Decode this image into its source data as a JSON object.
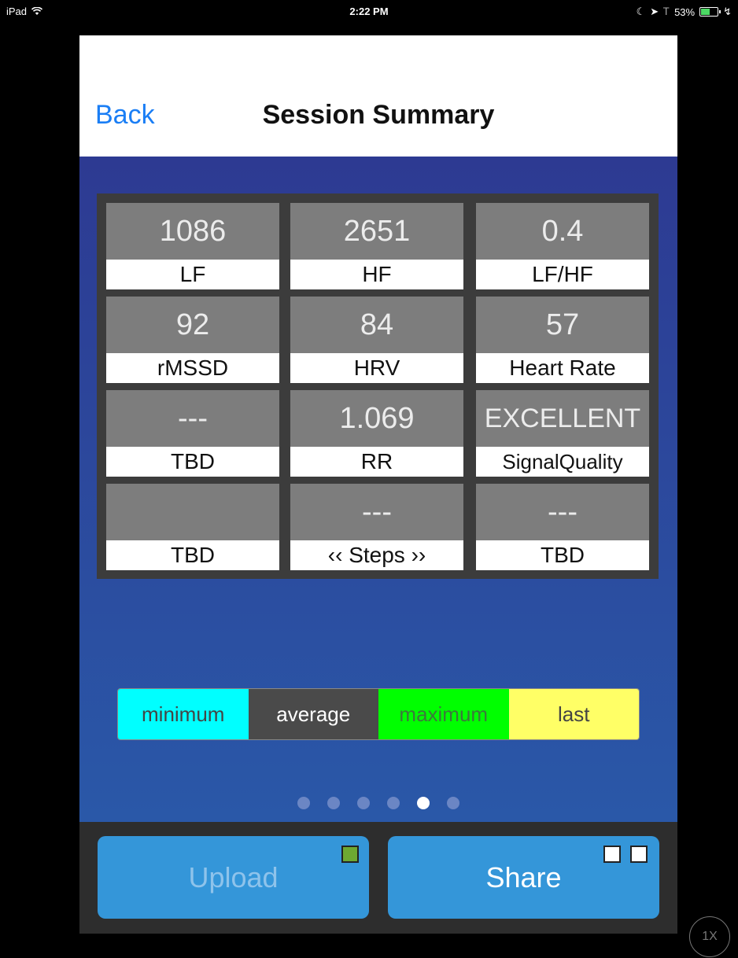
{
  "status_bar": {
    "device": "iPad",
    "time": "2:22 PM",
    "battery": "53%",
    "battery_level": 0.53
  },
  "nav": {
    "back_label": "Back",
    "title": "Session Summary"
  },
  "metrics": [
    {
      "value": "1086",
      "label": "LF"
    },
    {
      "value": "2651",
      "label": "HF"
    },
    {
      "value": "0.4",
      "label": "LF/HF"
    },
    {
      "value": "92",
      "label": "rMSSD"
    },
    {
      "value": "84",
      "label": "HRV"
    },
    {
      "value": "57",
      "label": "Heart Rate"
    },
    {
      "value": "---",
      "label": "TBD"
    },
    {
      "value": "1.069",
      "label": "RR"
    },
    {
      "value": "EXCELLENT",
      "label": "SignalQuality"
    },
    {
      "value": "",
      "label": "TBD"
    },
    {
      "value": "---",
      "label": "‹‹ Steps ››"
    },
    {
      "value": "---",
      "label": "TBD"
    }
  ],
  "legend": [
    {
      "label": "minimum",
      "bg": "#00ffff",
      "color": "#444444"
    },
    {
      "label": "average",
      "bg": "#4a4a4a",
      "color": "#ffffff"
    },
    {
      "label": "maximum",
      "bg": "#00ff00",
      "color": "#3b7a3b"
    },
    {
      "label": "last",
      "bg": "#ffff66",
      "color": "#444444"
    }
  ],
  "pager": {
    "count": 6,
    "active": 5
  },
  "buttons": {
    "upload_label": "Upload",
    "share_label": "Share"
  },
  "zoom_label": "1X"
}
